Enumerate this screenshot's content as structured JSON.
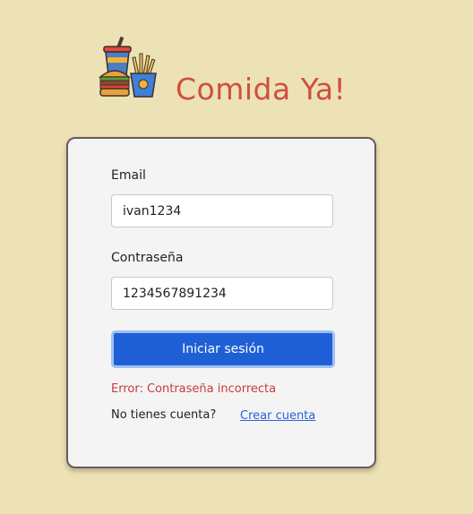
{
  "brand": {
    "title": "Comida Ya!",
    "logo_icon": "fast-food-combo-icon",
    "title_color": "#cf4f3f"
  },
  "login_form": {
    "email_label": "Email",
    "email_value": "ivan1234",
    "password_label": "Contraseña",
    "password_value": "1234567891234",
    "submit_label": "Iniciar sesión",
    "error_message": "Error: Contraseña incorrecta",
    "signup_prompt": "No tienes cuenta?",
    "signup_link": "Crear cuenta"
  },
  "colors": {
    "background": "#ede2b5",
    "primary_button": "#1f5fd6",
    "error": "#c83a3a",
    "link": "#2a62d8"
  }
}
